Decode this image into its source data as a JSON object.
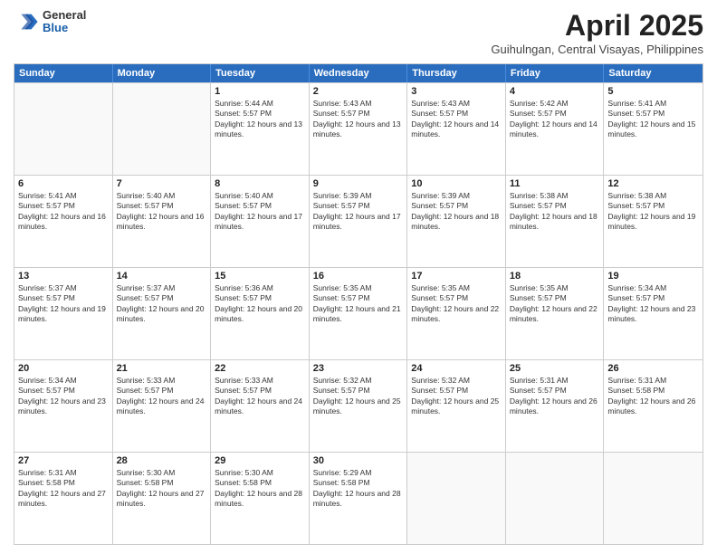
{
  "header": {
    "logo": {
      "general": "General",
      "blue": "Blue"
    },
    "title": "April 2025",
    "location": "Guihulngan, Central Visayas, Philippines"
  },
  "calendar": {
    "days_of_week": [
      "Sunday",
      "Monday",
      "Tuesday",
      "Wednesday",
      "Thursday",
      "Friday",
      "Saturday"
    ],
    "weeks": [
      [
        {
          "day": "",
          "sunrise": "",
          "sunset": "",
          "daylight": "",
          "empty": true
        },
        {
          "day": "",
          "sunrise": "",
          "sunset": "",
          "daylight": "",
          "empty": true
        },
        {
          "day": "1",
          "sunrise": "Sunrise: 5:44 AM",
          "sunset": "Sunset: 5:57 PM",
          "daylight": "Daylight: 12 hours and 13 minutes.",
          "empty": false
        },
        {
          "day": "2",
          "sunrise": "Sunrise: 5:43 AM",
          "sunset": "Sunset: 5:57 PM",
          "daylight": "Daylight: 12 hours and 13 minutes.",
          "empty": false
        },
        {
          "day": "3",
          "sunrise": "Sunrise: 5:43 AM",
          "sunset": "Sunset: 5:57 PM",
          "daylight": "Daylight: 12 hours and 14 minutes.",
          "empty": false
        },
        {
          "day": "4",
          "sunrise": "Sunrise: 5:42 AM",
          "sunset": "Sunset: 5:57 PM",
          "daylight": "Daylight: 12 hours and 14 minutes.",
          "empty": false
        },
        {
          "day": "5",
          "sunrise": "Sunrise: 5:41 AM",
          "sunset": "Sunset: 5:57 PM",
          "daylight": "Daylight: 12 hours and 15 minutes.",
          "empty": false
        }
      ],
      [
        {
          "day": "6",
          "sunrise": "Sunrise: 5:41 AM",
          "sunset": "Sunset: 5:57 PM",
          "daylight": "Daylight: 12 hours and 16 minutes.",
          "empty": false
        },
        {
          "day": "7",
          "sunrise": "Sunrise: 5:40 AM",
          "sunset": "Sunset: 5:57 PM",
          "daylight": "Daylight: 12 hours and 16 minutes.",
          "empty": false
        },
        {
          "day": "8",
          "sunrise": "Sunrise: 5:40 AM",
          "sunset": "Sunset: 5:57 PM",
          "daylight": "Daylight: 12 hours and 17 minutes.",
          "empty": false
        },
        {
          "day": "9",
          "sunrise": "Sunrise: 5:39 AM",
          "sunset": "Sunset: 5:57 PM",
          "daylight": "Daylight: 12 hours and 17 minutes.",
          "empty": false
        },
        {
          "day": "10",
          "sunrise": "Sunrise: 5:39 AM",
          "sunset": "Sunset: 5:57 PM",
          "daylight": "Daylight: 12 hours and 18 minutes.",
          "empty": false
        },
        {
          "day": "11",
          "sunrise": "Sunrise: 5:38 AM",
          "sunset": "Sunset: 5:57 PM",
          "daylight": "Daylight: 12 hours and 18 minutes.",
          "empty": false
        },
        {
          "day": "12",
          "sunrise": "Sunrise: 5:38 AM",
          "sunset": "Sunset: 5:57 PM",
          "daylight": "Daylight: 12 hours and 19 minutes.",
          "empty": false
        }
      ],
      [
        {
          "day": "13",
          "sunrise": "Sunrise: 5:37 AM",
          "sunset": "Sunset: 5:57 PM",
          "daylight": "Daylight: 12 hours and 19 minutes.",
          "empty": false
        },
        {
          "day": "14",
          "sunrise": "Sunrise: 5:37 AM",
          "sunset": "Sunset: 5:57 PM",
          "daylight": "Daylight: 12 hours and 20 minutes.",
          "empty": false
        },
        {
          "day": "15",
          "sunrise": "Sunrise: 5:36 AM",
          "sunset": "Sunset: 5:57 PM",
          "daylight": "Daylight: 12 hours and 20 minutes.",
          "empty": false
        },
        {
          "day": "16",
          "sunrise": "Sunrise: 5:35 AM",
          "sunset": "Sunset: 5:57 PM",
          "daylight": "Daylight: 12 hours and 21 minutes.",
          "empty": false
        },
        {
          "day": "17",
          "sunrise": "Sunrise: 5:35 AM",
          "sunset": "Sunset: 5:57 PM",
          "daylight": "Daylight: 12 hours and 22 minutes.",
          "empty": false
        },
        {
          "day": "18",
          "sunrise": "Sunrise: 5:35 AM",
          "sunset": "Sunset: 5:57 PM",
          "daylight": "Daylight: 12 hours and 22 minutes.",
          "empty": false
        },
        {
          "day": "19",
          "sunrise": "Sunrise: 5:34 AM",
          "sunset": "Sunset: 5:57 PM",
          "daylight": "Daylight: 12 hours and 23 minutes.",
          "empty": false
        }
      ],
      [
        {
          "day": "20",
          "sunrise": "Sunrise: 5:34 AM",
          "sunset": "Sunset: 5:57 PM",
          "daylight": "Daylight: 12 hours and 23 minutes.",
          "empty": false
        },
        {
          "day": "21",
          "sunrise": "Sunrise: 5:33 AM",
          "sunset": "Sunset: 5:57 PM",
          "daylight": "Daylight: 12 hours and 24 minutes.",
          "empty": false
        },
        {
          "day": "22",
          "sunrise": "Sunrise: 5:33 AM",
          "sunset": "Sunset: 5:57 PM",
          "daylight": "Daylight: 12 hours and 24 minutes.",
          "empty": false
        },
        {
          "day": "23",
          "sunrise": "Sunrise: 5:32 AM",
          "sunset": "Sunset: 5:57 PM",
          "daylight": "Daylight: 12 hours and 25 minutes.",
          "empty": false
        },
        {
          "day": "24",
          "sunrise": "Sunrise: 5:32 AM",
          "sunset": "Sunset: 5:57 PM",
          "daylight": "Daylight: 12 hours and 25 minutes.",
          "empty": false
        },
        {
          "day": "25",
          "sunrise": "Sunrise: 5:31 AM",
          "sunset": "Sunset: 5:57 PM",
          "daylight": "Daylight: 12 hours and 26 minutes.",
          "empty": false
        },
        {
          "day": "26",
          "sunrise": "Sunrise: 5:31 AM",
          "sunset": "Sunset: 5:58 PM",
          "daylight": "Daylight: 12 hours and 26 minutes.",
          "empty": false
        }
      ],
      [
        {
          "day": "27",
          "sunrise": "Sunrise: 5:31 AM",
          "sunset": "Sunset: 5:58 PM",
          "daylight": "Daylight: 12 hours and 27 minutes.",
          "empty": false
        },
        {
          "day": "28",
          "sunrise": "Sunrise: 5:30 AM",
          "sunset": "Sunset: 5:58 PM",
          "daylight": "Daylight: 12 hours and 27 minutes.",
          "empty": false
        },
        {
          "day": "29",
          "sunrise": "Sunrise: 5:30 AM",
          "sunset": "Sunset: 5:58 PM",
          "daylight": "Daylight: 12 hours and 28 minutes.",
          "empty": false
        },
        {
          "day": "30",
          "sunrise": "Sunrise: 5:29 AM",
          "sunset": "Sunset: 5:58 PM",
          "daylight": "Daylight: 12 hours and 28 minutes.",
          "empty": false
        },
        {
          "day": "",
          "sunrise": "",
          "sunset": "",
          "daylight": "",
          "empty": true
        },
        {
          "day": "",
          "sunrise": "",
          "sunset": "",
          "daylight": "",
          "empty": true
        },
        {
          "day": "",
          "sunrise": "",
          "sunset": "",
          "daylight": "",
          "empty": true
        }
      ]
    ]
  }
}
